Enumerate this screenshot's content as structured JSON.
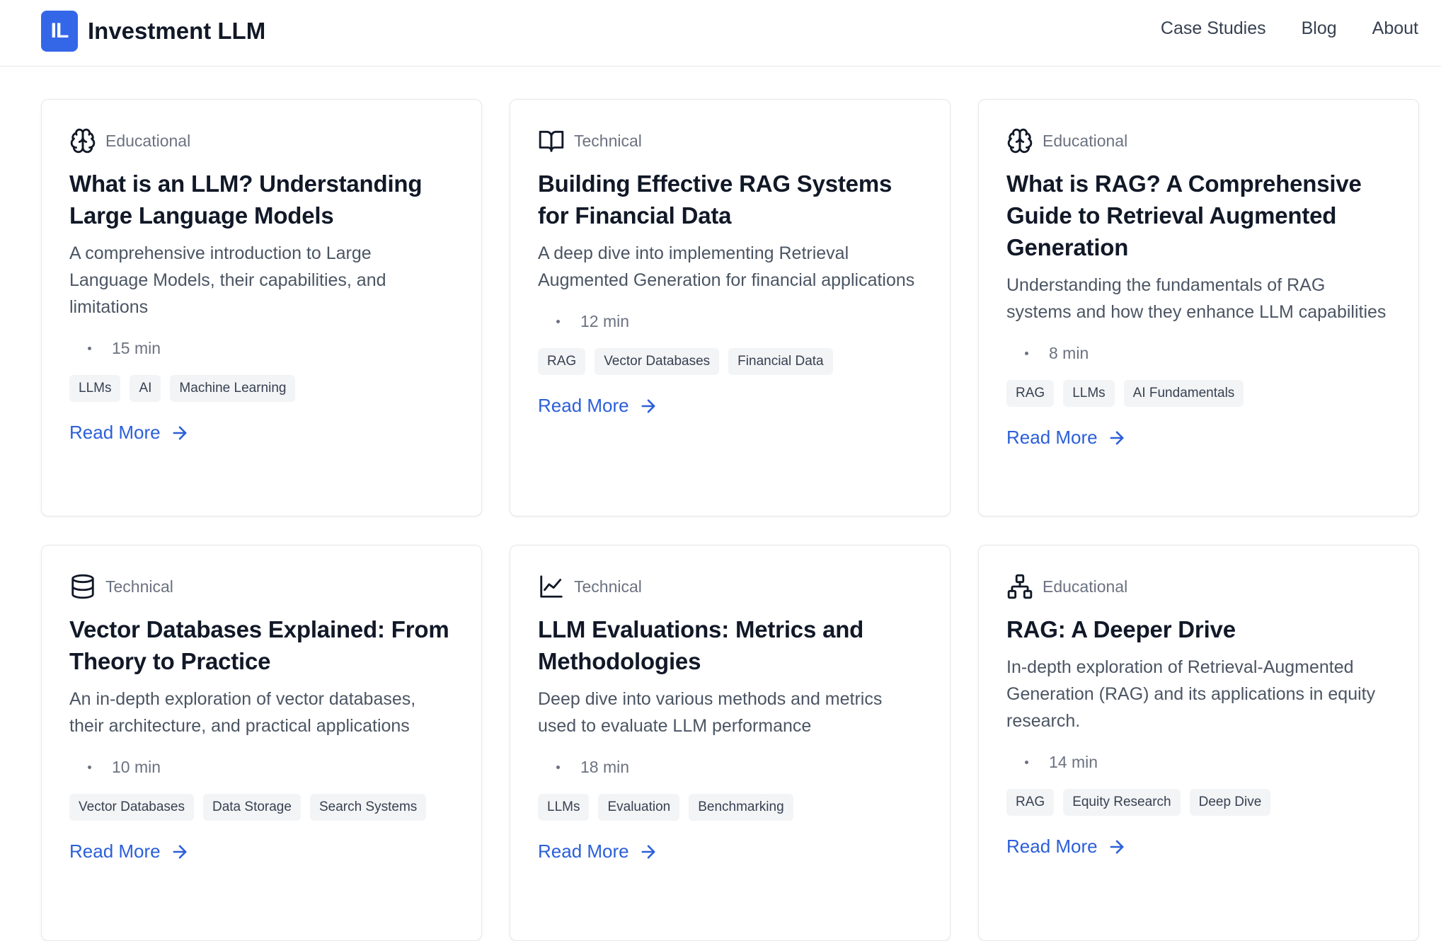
{
  "header": {
    "logo_mark": "IL",
    "brand": "Investment LLM",
    "nav": [
      "Case Studies",
      "Blog",
      "About"
    ]
  },
  "colors": {
    "accent": "#3467e8",
    "link": "#2b5fd9",
    "tag_bg": "#f3f4f6"
  },
  "cards": [
    {
      "icon": "brain-icon",
      "category": "Educational",
      "title": "What is an LLM? Understanding Large Language Models",
      "description": "A comprehensive introduction to Large Language Models, their capabilities, and limitations",
      "read_time": "15 min",
      "tags": [
        "LLMs",
        "AI",
        "Machine Learning"
      ],
      "cta": "Read More"
    },
    {
      "icon": "book-open-icon",
      "category": "Technical",
      "title": "Building Effective RAG Systems for Financial Data",
      "description": "A deep dive into implementing Retrieval Augmented Generation for financial applications",
      "read_time": "12 min",
      "tags": [
        "RAG",
        "Vector Databases",
        "Financial Data"
      ],
      "cta": "Read More"
    },
    {
      "icon": "brain-icon",
      "category": "Educational",
      "title": "What is RAG? A Comprehensive Guide to Retrieval Augmented Generation",
      "description": "Understanding the fundamentals of RAG systems and how they enhance LLM capabilities",
      "read_time": "8 min",
      "tags": [
        "RAG",
        "LLMs",
        "AI Fundamentals"
      ],
      "cta": "Read More"
    },
    {
      "icon": "database-icon",
      "category": "Technical",
      "title": "Vector Databases Explained: From Theory to Practice",
      "description": "An in-depth exploration of vector databases, their architecture, and practical applications",
      "read_time": "10 min",
      "tags": [
        "Vector Databases",
        "Data Storage",
        "Search Systems"
      ],
      "cta": "Read More"
    },
    {
      "icon": "line-chart-icon",
      "category": "Technical",
      "title": "LLM Evaluations: Metrics and Methodologies",
      "description": "Deep dive into various methods and metrics used to evaluate LLM performance",
      "read_time": "18 min",
      "tags": [
        "LLMs",
        "Evaluation",
        "Benchmarking"
      ],
      "cta": "Read More"
    },
    {
      "icon": "network-icon",
      "category": "Educational",
      "title": "RAG: A Deeper Drive",
      "description": "In-depth exploration of Retrieval-Augmented Generation (RAG) and its applications in equity research.",
      "read_time": "14 min",
      "tags": [
        "RAG",
        "Equity Research",
        "Deep Dive"
      ],
      "cta": "Read More"
    }
  ]
}
